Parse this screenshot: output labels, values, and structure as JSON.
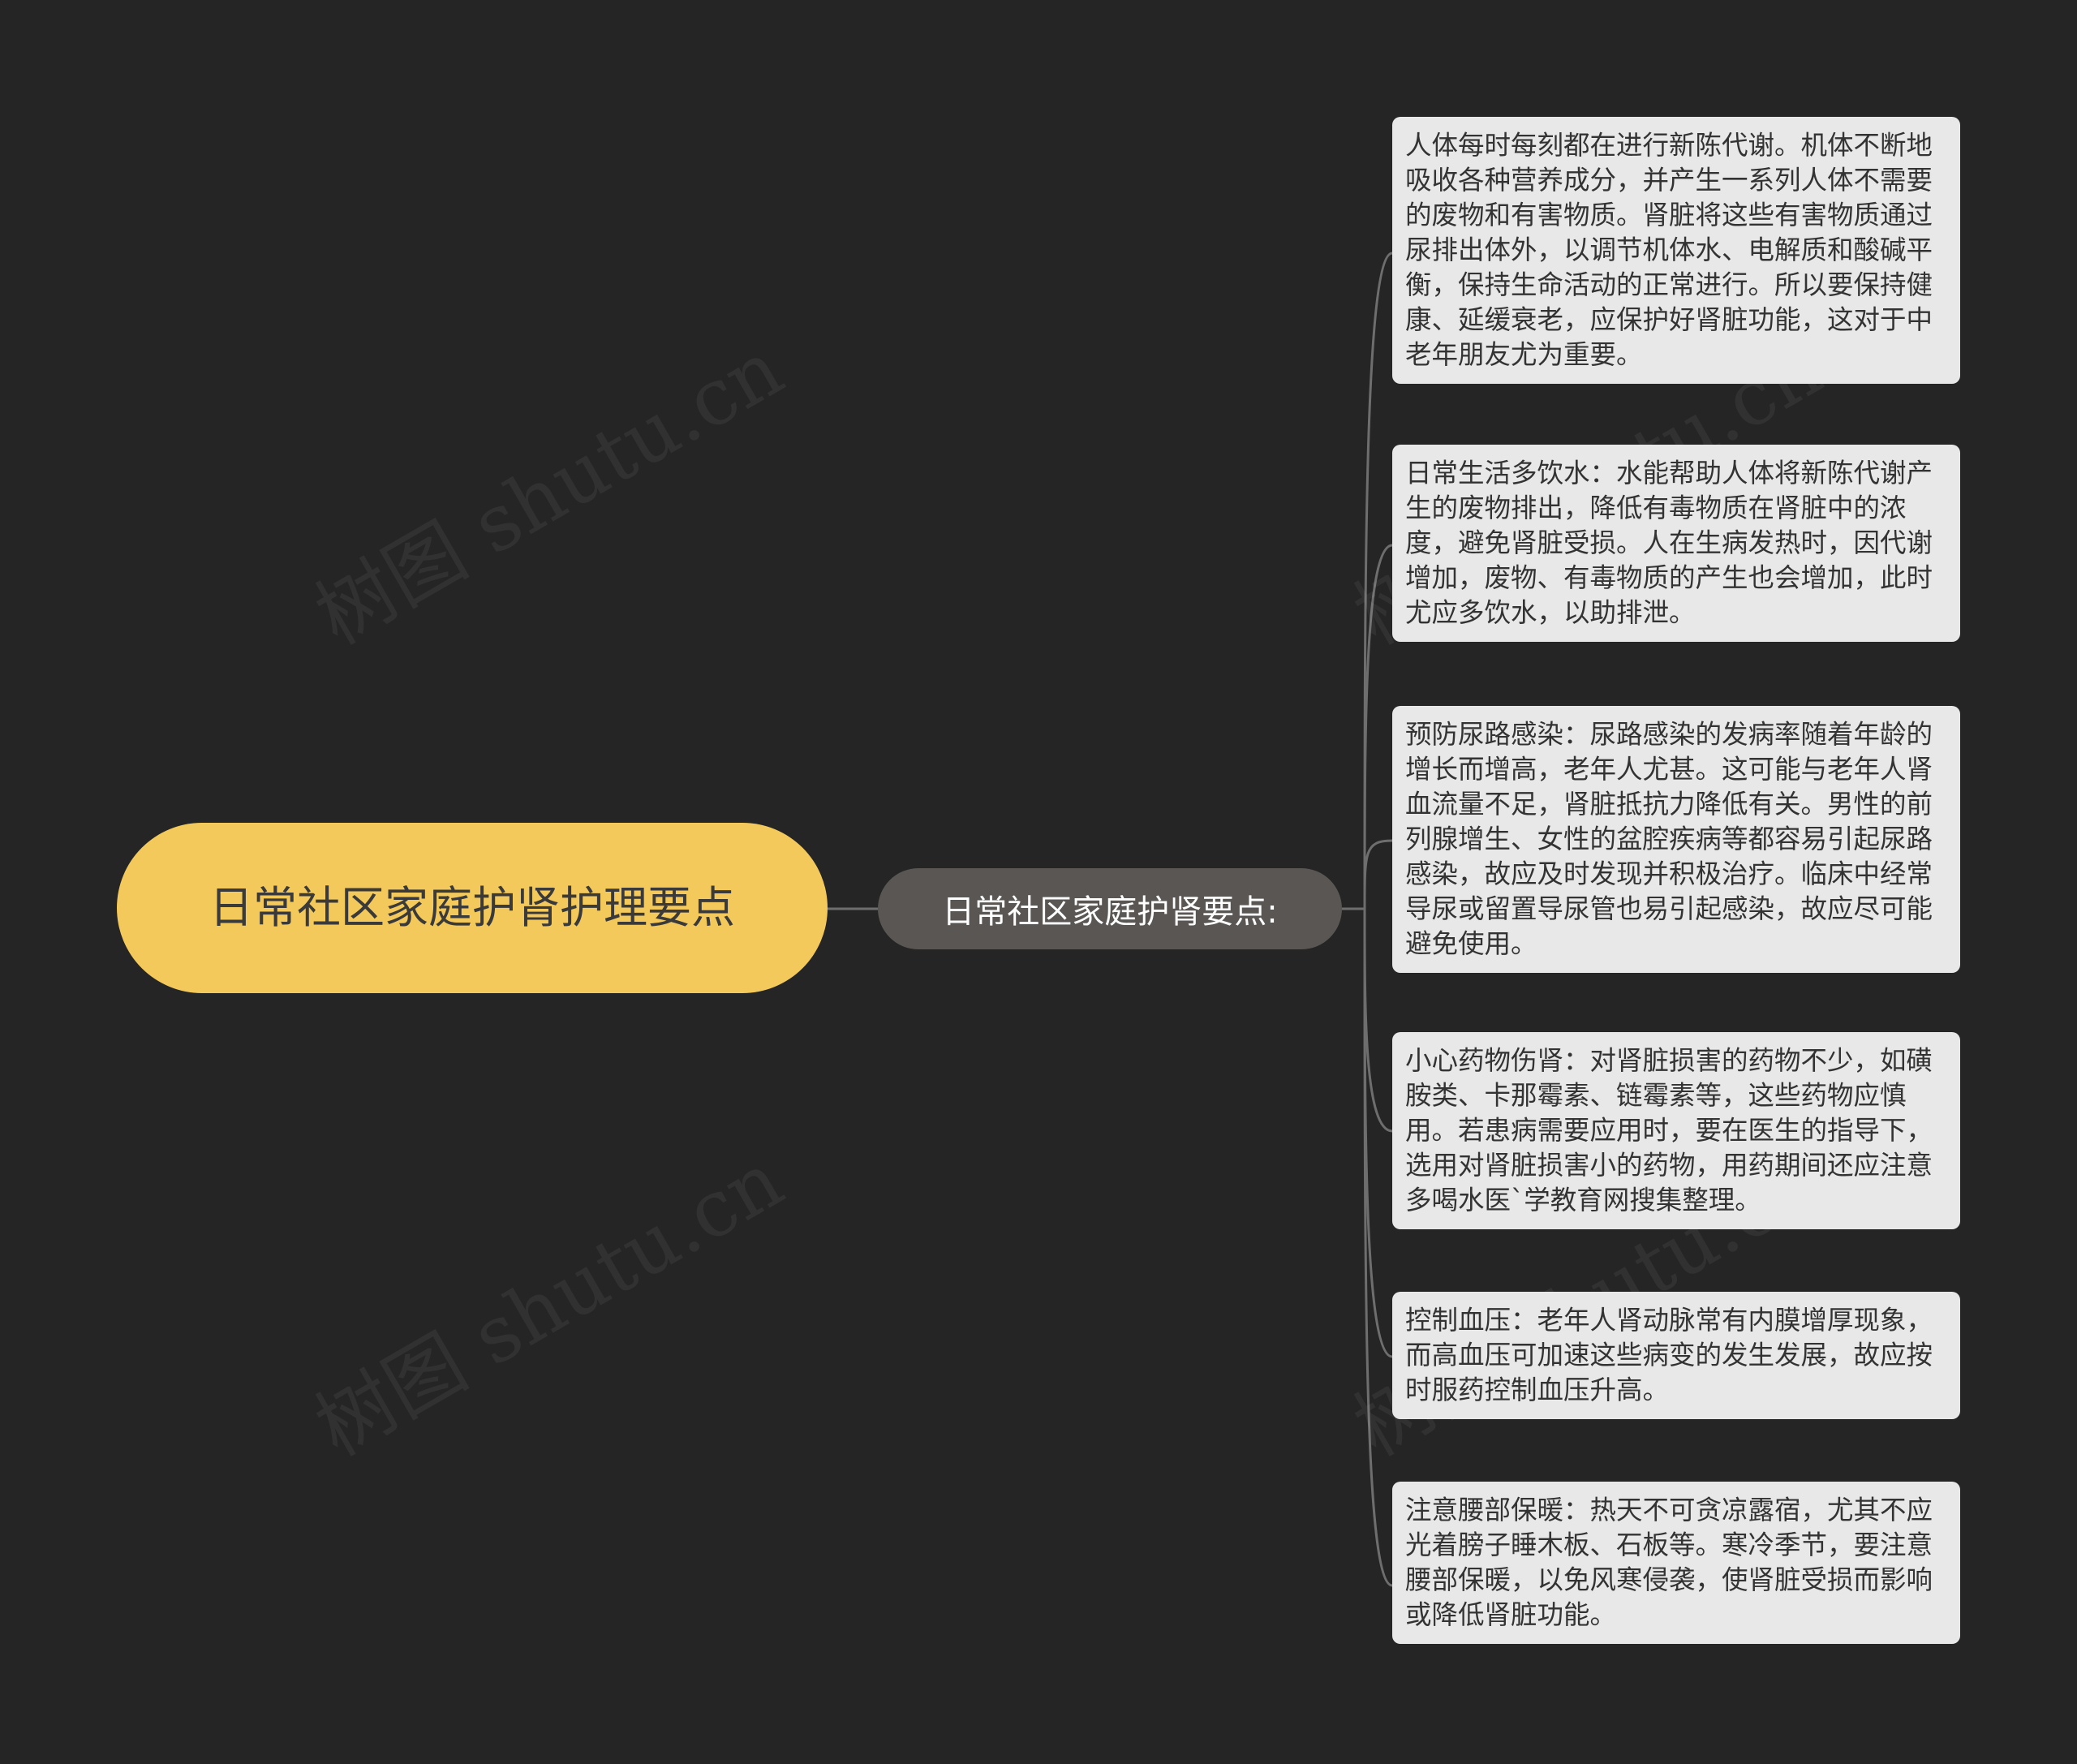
{
  "colors": {
    "background": "#252525",
    "root_fill": "#f3c95b",
    "branch_fill": "#5a5654",
    "leaf_fill": "#e8e8e8",
    "connector": "#6e6e6e"
  },
  "watermark": {
    "text": "树图 shutu.cn"
  },
  "mindmap": {
    "root": {
      "label": "日常社区家庭护肾护理要点"
    },
    "branch": {
      "label": "日常社区家庭护肾要点:"
    },
    "leaves": [
      {
        "text": "人体每时每刻都在进行新陈代谢。机体不断地吸收各种营养成分，并产生一系列人体不需要的废物和有害物质。肾脏将这些有害物质通过尿排出体外，以调节机体水、电解质和酸碱平衡，保持生命活动的正常进行。所以要保持健康、延缓衰老，应保护好肾脏功能，这对于中老年朋友尤为重要。"
      },
      {
        "text": "日常生活多饮水：水能帮助人体将新陈代谢产生的废物排出，降低有毒物质在肾脏中的浓度，避免肾脏受损。人在生病发热时，因代谢增加，废物、有毒物质的产生也会增加，此时尤应多饮水，以助排泄。"
      },
      {
        "text": "预防尿路感染：尿路感染的发病率随着年龄的增长而增高，老年人尤甚。这可能与老年人肾血流量不足，肾脏抵抗力降低有关。男性的前列腺增生、女性的盆腔疾病等都容易引起尿路感染，故应及时发现并积极治疗。临床中经常导尿或留置导尿管也易引起感染，故应尽可能避免使用。"
      },
      {
        "text": "小心药物伤肾：对肾脏损害的药物不少，如磺胺类、卡那霉素、链霉素等，这些药物应慎用。若患病需要应用时，要在医生的指导下，选用对肾脏损害小的药物，用药期间还应注意多喝水医`学教育网搜集整理。"
      },
      {
        "text": "控制血压：老年人肾动脉常有内膜增厚现象，而高血压可加速这些病变的发生发展，故应按时服药控制血压升高。"
      },
      {
        "text": "注意腰部保暖：热天不可贪凉露宿，尤其不应光着膀子睡木板、石板等。寒冷季节，要注意腰部保暖，以免风寒侵袭，使肾脏受损而影响或降低肾脏功能。"
      }
    ]
  }
}
